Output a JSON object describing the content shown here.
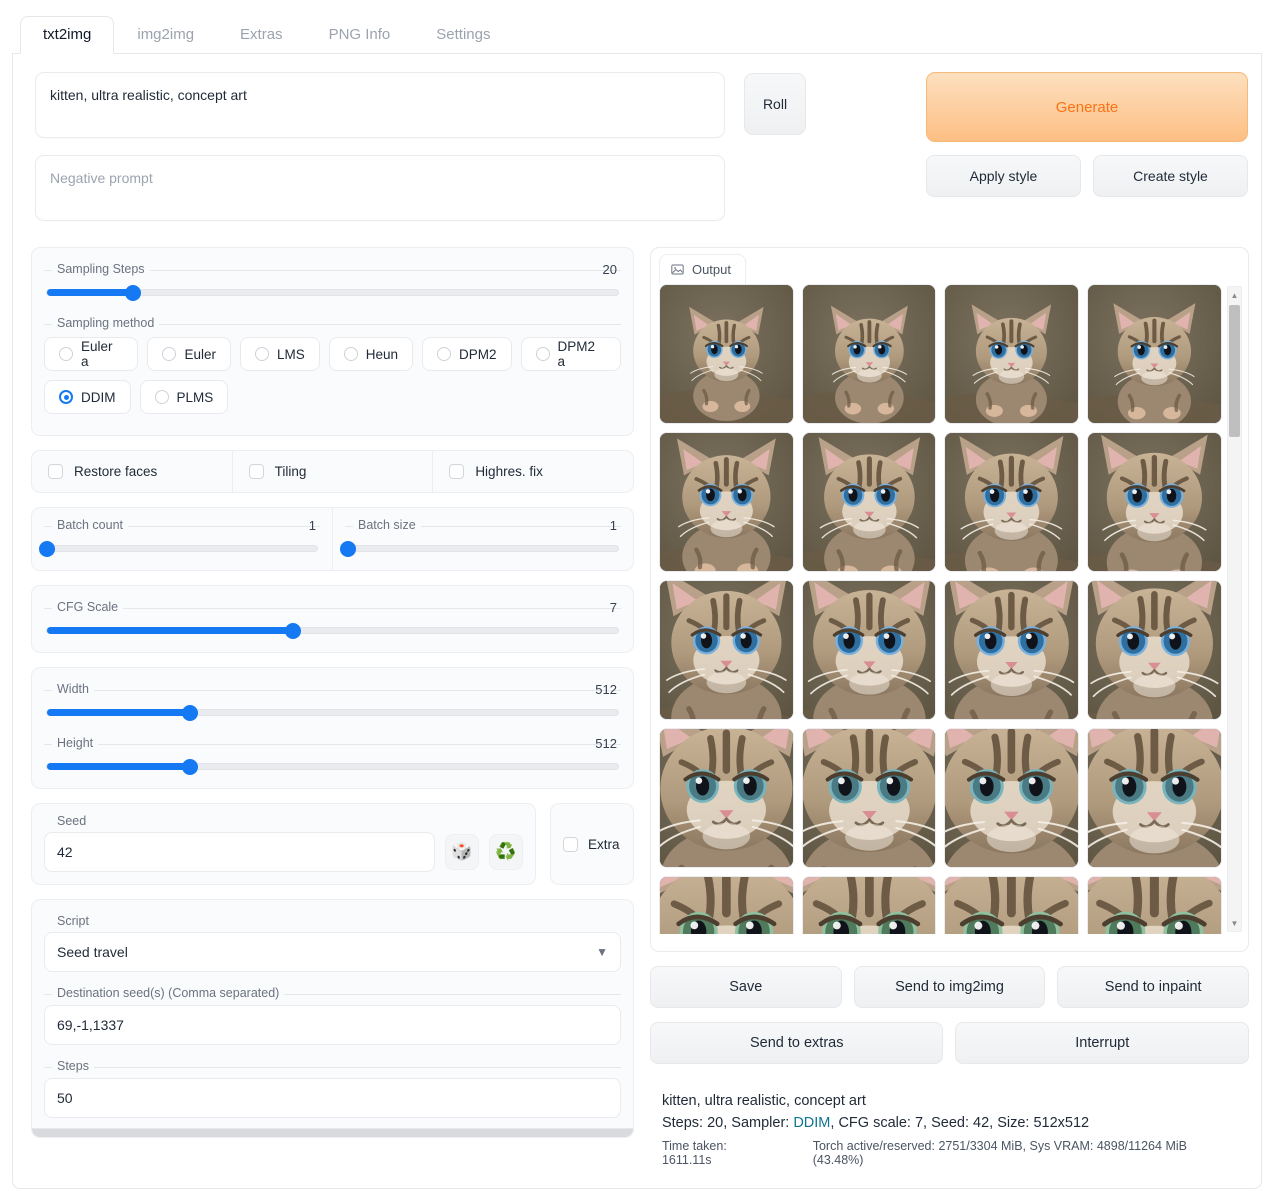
{
  "tabs": [
    {
      "label": "txt2img",
      "active": true
    },
    {
      "label": "img2img",
      "active": false
    },
    {
      "label": "Extras",
      "active": false
    },
    {
      "label": "PNG Info",
      "active": false
    },
    {
      "label": "Settings",
      "active": false
    }
  ],
  "prompt": {
    "value": "kitten, ultra realistic, concept art",
    "negative_placeholder": "Negative prompt"
  },
  "actions": {
    "roll": "Roll",
    "generate": "Generate",
    "apply_style": "Apply style",
    "create_style": "Create style"
  },
  "sampling": {
    "steps_label": "Sampling Steps",
    "steps_value": "20",
    "steps_percent": 15,
    "method_label": "Sampling method",
    "methods_row1": [
      {
        "label": "Euler a",
        "selected": false
      },
      {
        "label": "Euler",
        "selected": false
      },
      {
        "label": "LMS",
        "selected": false
      },
      {
        "label": "Heun",
        "selected": false
      },
      {
        "label": "DPM2",
        "selected": false
      },
      {
        "label": "DPM2 a",
        "selected": false
      }
    ],
    "methods_row2": [
      {
        "label": "DDIM",
        "selected": true
      },
      {
        "label": "PLMS",
        "selected": false
      }
    ]
  },
  "toggles": [
    {
      "label": "Restore faces",
      "checked": false
    },
    {
      "label": "Tiling",
      "checked": false
    },
    {
      "label": "Highres. fix",
      "checked": false
    }
  ],
  "batch": {
    "count_label": "Batch count",
    "count_value": "1",
    "count_percent": 0,
    "size_label": "Batch size",
    "size_value": "1",
    "size_percent": 0
  },
  "cfg": {
    "label": "CFG Scale",
    "value": "7",
    "percent": 43
  },
  "dimensions": {
    "width_label": "Width",
    "width_value": "512",
    "width_percent": 25,
    "height_label": "Height",
    "height_value": "512",
    "height_percent": 25
  },
  "seed": {
    "label": "Seed",
    "value": "42",
    "dice_icon": "dice-icon",
    "recycle_icon": "recycle-icon",
    "extra_label": "Extra",
    "extra_checked": false
  },
  "script": {
    "label": "Script",
    "selected": "Seed travel",
    "dest_label": "Destination seed(s) (Comma separated)",
    "dest_value": "69,-1,1337",
    "steps_label": "Steps",
    "steps_value": "50"
  },
  "output": {
    "tab_label": "Output",
    "tab_icon": "image-icon",
    "images_count": 20
  },
  "result_actions": {
    "row1": [
      "Save",
      "Send to img2img",
      "Send to inpaint"
    ],
    "row2": [
      "Send to extras",
      "Interrupt"
    ]
  },
  "info": {
    "prompt_line": "kitten, ultra realistic, concept art",
    "params_prefix": "Steps: 20, Sampler: ",
    "params_accent": "DDIM",
    "params_suffix": ", CFG scale: 7, Seed: 42, Size: 512x512",
    "time_taken": "Time taken: 1611.11s",
    "torch_stats": "Torch active/reserved: 2751/3304 MiB, Sys VRAM: 4898/11264 MiB (43.48%)"
  },
  "colors": {
    "accent_blue": "#1479f2",
    "generate_orange": "#f97316",
    "link_teal": "#0e7490"
  }
}
